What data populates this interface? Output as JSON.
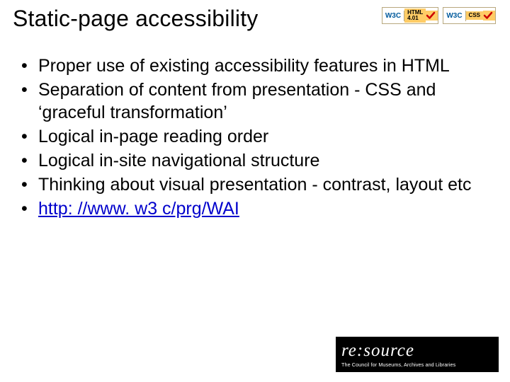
{
  "title": "Static-page accessibility",
  "badges": {
    "html": {
      "w3c": "W3C",
      "line1": "HTML",
      "line2": "4.01"
    },
    "css": {
      "w3c": "W3C",
      "line1": "",
      "line2": "CSS"
    }
  },
  "bullets": [
    "Proper use of existing accessibility features in HTML",
    "Separation of content from presentation - CSS and ‘graceful transformation’",
    "Logical in-page reading order",
    "Logical in-site navigational structure",
    "Thinking about visual presentation - contrast, layout etc"
  ],
  "link_text": "http: //www. w3 c/prg/WAI",
  "footer": {
    "brand": "re:source",
    "sub": "The Council for Museums, Archives and Libraries"
  }
}
